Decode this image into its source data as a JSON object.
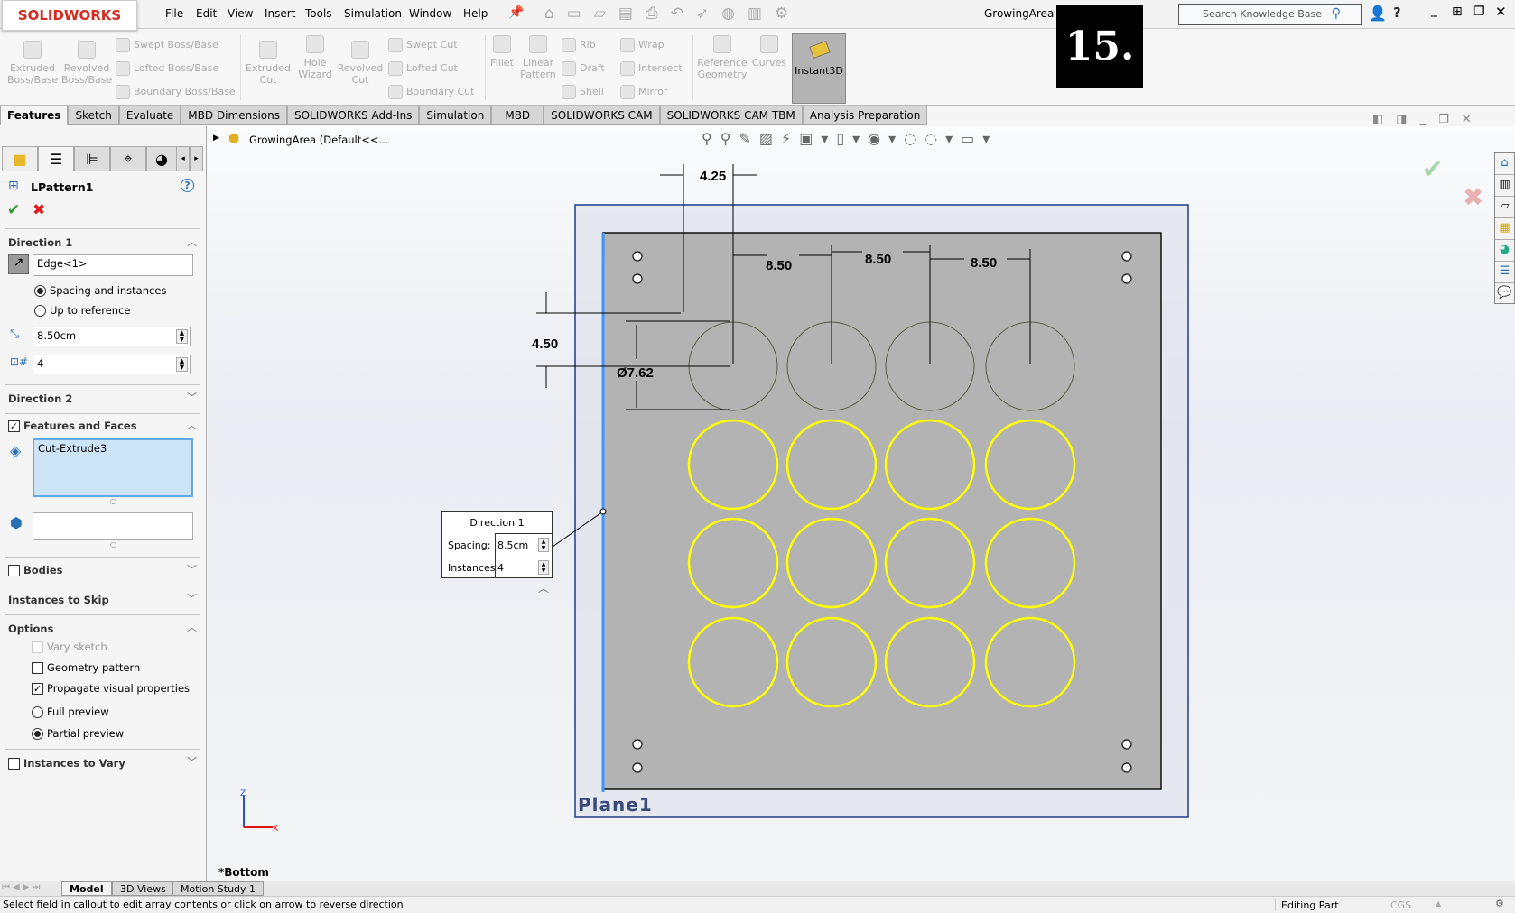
{
  "app": {
    "logo": "SOLIDWORKS",
    "title": "GrowingArea *",
    "step_badge": "15."
  },
  "menu": [
    "File",
    "Edit",
    "View",
    "Insert",
    "Tools",
    "Simulation",
    "Window",
    "Help"
  ],
  "search": {
    "placeholder": "Search Knowledge Base"
  },
  "ribbon": {
    "extruded_boss": "Extruded Boss/Base",
    "revolved_boss": "Revolved Boss/Base",
    "swept_boss": "Swept Boss/Base",
    "lofted_boss": "Lofted Boss/Base",
    "boundary_boss": "Boundary Boss/Base",
    "extruded_cut": "Extruded Cut",
    "hole_wizard": "Hole Wizard",
    "revolved_cut": "Revolved Cut",
    "swept_cut": "Swept Cut",
    "lofted_cut": "Lofted Cut",
    "boundary_cut": "Boundary Cut",
    "fillet": "Fillet",
    "linear_pattern": "Linear Pattern",
    "rib": "Rib",
    "draft": "Draft",
    "shell": "Shell",
    "wrap": "Wrap",
    "intersect": "Intersect",
    "mirror": "Mirror",
    "reference_geometry": "Reference Geometry",
    "curves": "Curves",
    "instant3d": "Instant3D"
  },
  "tabs": [
    "Features",
    "Sketch",
    "Evaluate",
    "MBD Dimensions",
    "SOLIDWORKS Add-Ins",
    "Simulation",
    "MBD",
    "SOLIDWORKS CAM",
    "SOLIDWORKS CAM TBM",
    "Analysis Preparation"
  ],
  "property_manager": {
    "title": "LPattern1",
    "direction1": {
      "label": "Direction 1",
      "edge": "Edge<1>",
      "spacing_and_instances": "Spacing and instances",
      "up_to_reference": "Up to reference",
      "spacing": "8.50cm",
      "instances": "4",
      "mode": "Spacing and instances"
    },
    "direction2": {
      "label": "Direction 2"
    },
    "features_and_faces": {
      "label": "Features and Faces",
      "checked": true,
      "items": [
        "Cut-Extrude3"
      ]
    },
    "bodies": {
      "label": "Bodies",
      "checked": false
    },
    "instances_to_skip": {
      "label": "Instances to Skip"
    },
    "options": {
      "label": "Options",
      "vary_sketch": "Vary sketch",
      "geometry_pattern": "Geometry pattern",
      "propagate": "Propagate visual properties",
      "full_preview": "Full preview",
      "partial_preview": "Partial preview",
      "geometry_pattern_checked": false,
      "propagate_checked": true,
      "preview": "Partial preview"
    },
    "instances_to_vary": {
      "label": "Instances to Vary",
      "checked": false
    }
  },
  "tree": {
    "part": "GrowingArea  (Default<<..."
  },
  "drawing": {
    "dims": {
      "edge_offset_x": "4.25",
      "spacing1": "8.50",
      "spacing2": "8.50",
      "spacing3": "8.50",
      "edge_offset_y": "4.50",
      "diameter": "Ø7.62"
    },
    "plane_label": "Plane1",
    "view_label": "*Bottom",
    "colors": {
      "plate": "#b3b3b3",
      "circle": "#ffff00",
      "plane_border": "#1f3c88",
      "edge_highlight": "#3c96ff"
    }
  },
  "callout": {
    "title": "Direction 1",
    "spacing_label": "Spacing:",
    "spacing": "8.5cm",
    "instances_label": "Instances:",
    "instances": "4"
  },
  "bottom_tabs": [
    "Model",
    "3D Views",
    "Motion Study 1"
  ],
  "status": {
    "message": "Select field in callout to edit array contents or click on arrow to reverse direction",
    "mode": "Editing Part",
    "units": "CGS"
  }
}
